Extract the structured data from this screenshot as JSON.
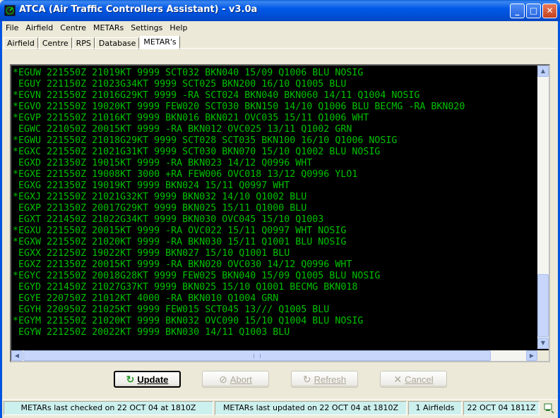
{
  "window": {
    "title": "ATCA (Air Traffic Controllers Assistant) - v3.0a",
    "min_glyph": "_",
    "max_glyph": "□",
    "close_glyph": "✕"
  },
  "menu": [
    "File",
    "Airfield",
    "Centre",
    "METARs",
    "Settings",
    "Help"
  ],
  "tabs": [
    "Airfield",
    "Centre",
    "RPS",
    "Database",
    "METAR's"
  ],
  "active_tab": "METAR's",
  "metar_marker": "*",
  "metars": [
    {
      "starred": true,
      "text": "EGUW 221550Z 21019KT 9999 SCT032 BKN040 15/09 Q1006 BLU NOSIG"
    },
    {
      "starred": false,
      "text": "EGUY 221150Z 21023G34KT 9999 SCT025 BKN200 16/10 Q1005 BLU"
    },
    {
      "starred": true,
      "text": "EGVN 221550Z 21016G29KT 9999 -RA SCT024 BKN040 BKN060 14/11 Q1004 NOSIG"
    },
    {
      "starred": true,
      "text": "EGVO 221550Z 19020KT 9999 FEW020 SCT030 BKN150 14/10 Q1006 BLU BECMG -RA BKN020"
    },
    {
      "starred": true,
      "text": "EGVP 221550Z 21016KT 9999 BKN016 BKN021 OVC035 15/11 Q1006 WHT"
    },
    {
      "starred": false,
      "text": "EGWC 221050Z 20015KT 9999 -RA BKN012 OVC025 13/11 Q1002 GRN"
    },
    {
      "starred": true,
      "text": "EGWU 221550Z 21018G29KT 9999 SCT028 SCT035 BKN100 16/10 Q1006 NOSIG"
    },
    {
      "starred": true,
      "text": "EGXC 221550Z 21021G31KT 9999 SCT030 BKN070 15/10 Q1002 BLU NOSIG"
    },
    {
      "starred": false,
      "text": "EGXD 221350Z 19015KT 9999 -RA BKN023 14/12 Q0996 WHT"
    },
    {
      "starred": true,
      "text": "EGXE 221550Z 19008KT 3000 +RA FEW006 OVC018 13/12 Q0996 YLO1"
    },
    {
      "starred": false,
      "text": "EGXG 221350Z 19019KT 9999 BKN024 15/11 Q0997 WHT"
    },
    {
      "starred": true,
      "text": "EGXJ 221550Z 21021G32KT 9999 BKN032 14/10 Q1002 BLU"
    },
    {
      "starred": false,
      "text": "EGXP 221350Z 20017G29KT 9999 BKN025 15/11 Q1000 BLU"
    },
    {
      "starred": false,
      "text": "EGXT 221450Z 21022G34KT 9999 BKN030 OVC045 15/10 Q1003"
    },
    {
      "starred": true,
      "text": "EGXU 221550Z 20015KT 9999 -RA OVC022 15/11 Q0997 WHT NOSIG"
    },
    {
      "starred": true,
      "text": "EGXW 221550Z 21020KT 9999 -RA BKN030 15/11 Q1001 BLU NOSIG"
    },
    {
      "starred": false,
      "text": "EGXX 221250Z 19022KT 9999 BKN027 15/10 Q1001 BLU"
    },
    {
      "starred": false,
      "text": "EGXZ 221350Z 20015KT 9999 -RA BKN020 OVC030 14/12 Q0996 WHT"
    },
    {
      "starred": true,
      "text": "EGYC 221550Z 20018G28KT 9999 FEW025 BKN040 15/09 Q1005 BLU NOSIG"
    },
    {
      "starred": false,
      "text": "EGYD 221450Z 21027G37KT 9999 BKN025 15/10 Q1001 BECMG BKN018"
    },
    {
      "starred": false,
      "text": "EGYE 220750Z 21012KT 4000 -RA BKN010 Q1004 GRN"
    },
    {
      "starred": false,
      "text": "EGYH 220950Z 21025KT 9999 FEW015 SCT045 13/// Q1005 BLU"
    },
    {
      "starred": true,
      "text": "EGYM 221550Z 21020KT 9999 BKN032 OVC090 15/10 Q1004 BLU NOSIG"
    },
    {
      "starred": false,
      "text": "EGYW 221250Z 20022KT 9999 BKN030 14/11 Q1003 BLU"
    }
  ],
  "scrollbar": {
    "up_glyph": "▲",
    "down_glyph": "▼",
    "left_glyph": "◀",
    "right_glyph": "▶"
  },
  "buttons": {
    "update": {
      "label": "Update",
      "icon": "↻"
    },
    "abort": {
      "label": "Abort",
      "icon": "⊘"
    },
    "refresh": {
      "label": "Refresh",
      "icon": "↻"
    },
    "cancel": {
      "label": "Cancel",
      "icon": "✕"
    }
  },
  "status": {
    "last_checked": "METARs last checked on 22 OCT 04 at 1810Z",
    "last_updated": "METARs last updated on 22 OCT 04 at 1810Z",
    "airfields": "1 Airfields",
    "datetime": "22 OCT 04 1811Z"
  },
  "colors": {
    "metar_text": "#00c000",
    "metar_bg": "#000000",
    "status_panel": "#ccf0ee"
  }
}
